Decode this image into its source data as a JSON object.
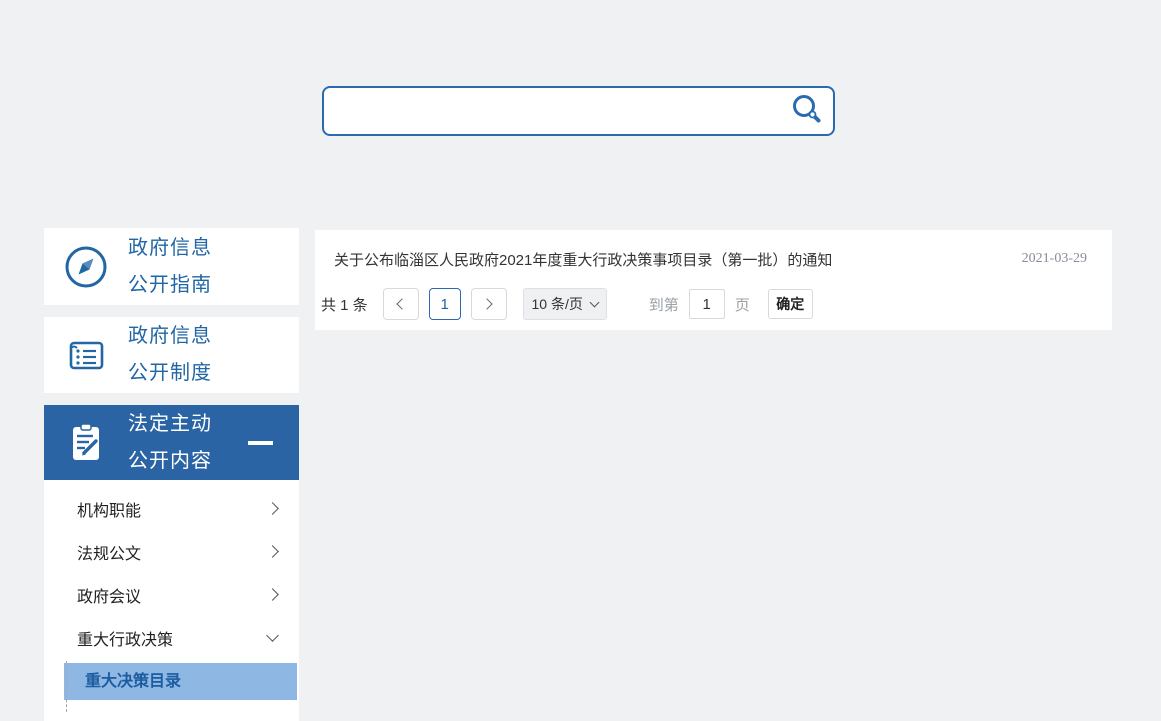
{
  "colors": {
    "accent_blue": "#2a64a4",
    "link_blue": "#2266a5",
    "highlight_blue": "#8fb7e3",
    "page_bg": "#f0f1f2",
    "border_gray": "#d9d9d9",
    "active_page_blue": "#1f62a8",
    "muted_text": "#9aa0a6",
    "date_gray": "#8b8b97"
  },
  "search": {
    "value": "",
    "placeholder": ""
  },
  "sidebar": {
    "items": [
      {
        "line1": "政府信息",
        "line2": "公开指南",
        "icon": "compass-icon"
      },
      {
        "line1": "政府信息",
        "line2": "公开制度",
        "icon": "ledger-icon"
      },
      {
        "line1": "法定主动",
        "line2": "公开内容",
        "icon": "clipboard-pencil-icon"
      }
    ],
    "subitems": [
      {
        "label": "机构职能"
      },
      {
        "label": "法规公文"
      },
      {
        "label": "政府会议"
      },
      {
        "label": "重大行政决策"
      }
    ],
    "nested_item": {
      "label": "重大决策目录"
    }
  },
  "main": {
    "list": [
      {
        "title": "关于公布临淄区人民政府2021年度重大行政决策事项目录（第一批）的通知",
        "date": "2021-03-29"
      }
    ],
    "pagination": {
      "total": "共 1 条",
      "current_page": "1",
      "page_size": "10 条/页",
      "goto_prefix": "到第",
      "goto_value": "1",
      "goto_suffix": "页",
      "confirm": "确定"
    }
  }
}
